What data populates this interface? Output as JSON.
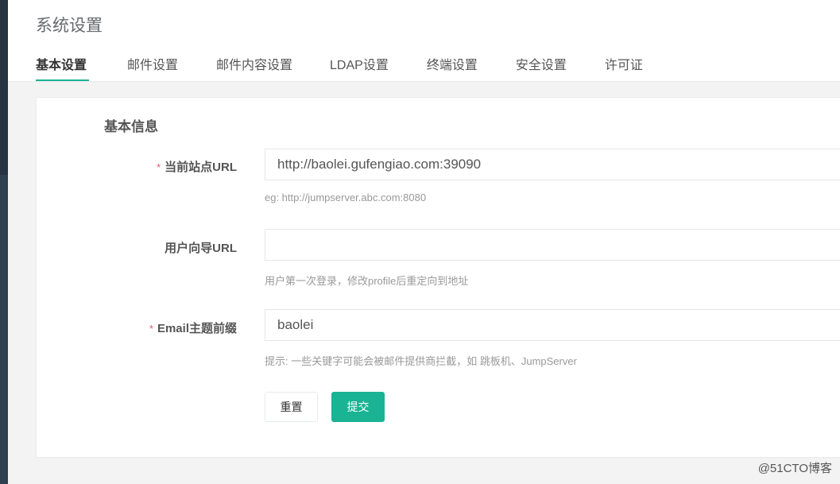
{
  "header": {
    "title": "系统设置",
    "tabs": [
      {
        "label": "基本设置",
        "active": true
      },
      {
        "label": "邮件设置",
        "active": false
      },
      {
        "label": "邮件内容设置",
        "active": false
      },
      {
        "label": "LDAP设置",
        "active": false
      },
      {
        "label": "终端设置",
        "active": false
      },
      {
        "label": "安全设置",
        "active": false
      },
      {
        "label": "许可证",
        "active": false
      }
    ]
  },
  "form": {
    "section_title": "基本信息",
    "site_url": {
      "required_mark": "*",
      "label": "当前站点URL",
      "value": "http://baolei.gufengiao.com:39090",
      "help": "eg: http://jumpserver.abc.com:8080"
    },
    "user_guide_url": {
      "label": "用户向导URL",
      "value": "",
      "help": "用户第一次登录，修改profile后重定向到地址"
    },
    "email_subject_prefix": {
      "required_mark": "*",
      "label": "Email主题前缀",
      "value": "baolei",
      "help": "提示: 一些关键字可能会被邮件提供商拦截，如 跳板机、JumpServer"
    },
    "reset_label": "重置",
    "submit_label": "提交"
  },
  "watermark": "@51CTO博客",
  "colors": {
    "accent": "#1ab394",
    "required": "#ed5565"
  }
}
